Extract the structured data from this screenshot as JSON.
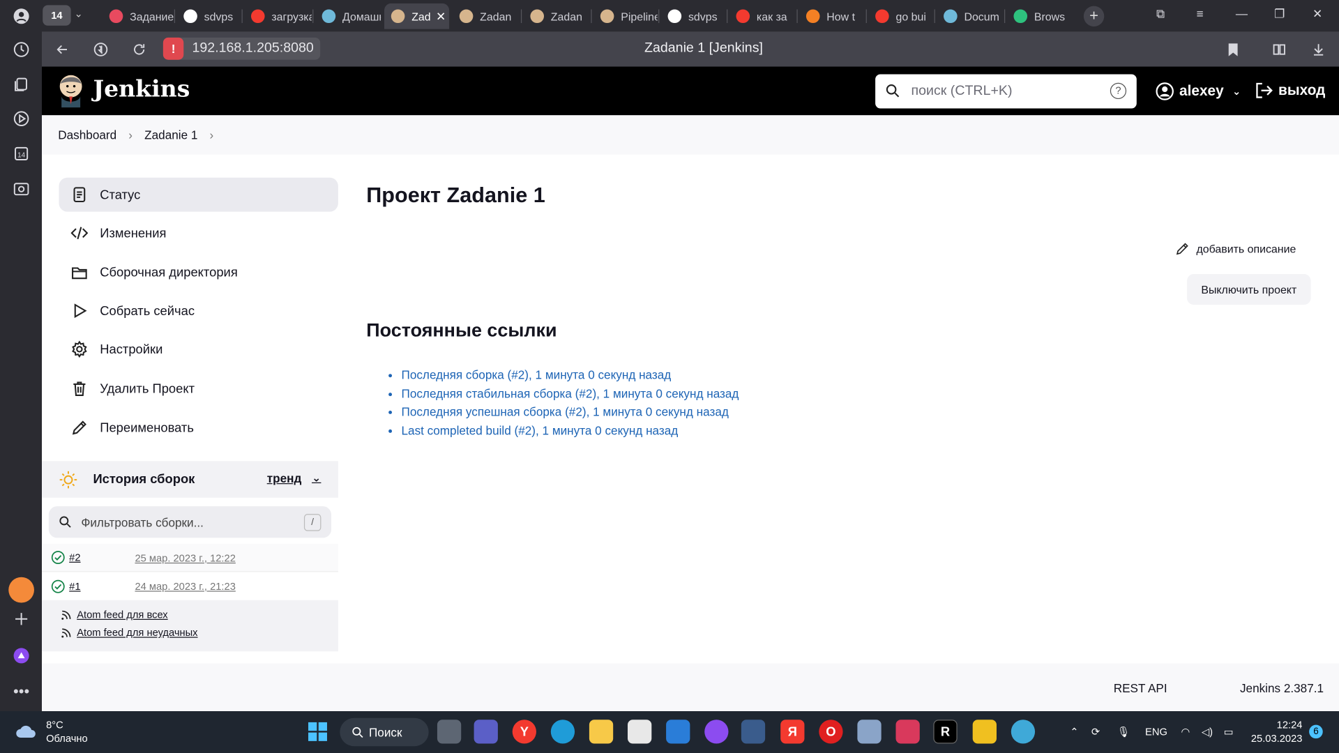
{
  "browser": {
    "tab_count": "14",
    "tabs": [
      {
        "label": "Задание",
        "color": "#e84a5f"
      },
      {
        "label": "sdvps",
        "color": "#ffffff"
      },
      {
        "label": "загрузка",
        "color": "#f33a2f"
      },
      {
        "label": "Домашнее",
        "color": "#6fb9d9"
      },
      {
        "label": "Zad",
        "color": "#d6b58d",
        "active": true
      },
      {
        "label": "Zadan",
        "color": "#d6b58d"
      },
      {
        "label": "Zadan",
        "color": "#d6b58d"
      },
      {
        "label": "Pipeline",
        "color": "#d6b58d"
      },
      {
        "label": "sdvps",
        "color": "#ffffff"
      },
      {
        "label": "как за",
        "color": "#f33a2f"
      },
      {
        "label": "How t",
        "color": "#f48024"
      },
      {
        "label": "go bui",
        "color": "#f33a2f"
      },
      {
        "label": "Docum",
        "color": "#6fb9d9"
      },
      {
        "label": "Brows",
        "color": "#2ec27e"
      }
    ],
    "url": "192.168.1.205:8080",
    "page_title": "Zadanie 1 [Jenkins]"
  },
  "header": {
    "brand": "Jenkins",
    "search_placeholder": "поиск (CTRL+K)",
    "help": "?",
    "user": "alexey",
    "logout": "выход"
  },
  "breadcrumb": {
    "items": [
      "Dashboard",
      "Zadanie 1"
    ]
  },
  "sidebar": {
    "items": [
      {
        "label": "Статус",
        "icon": "document-icon"
      },
      {
        "label": "Изменения",
        "icon": "code-icon"
      },
      {
        "label": "Сборочная директория",
        "icon": "folder-icon"
      },
      {
        "label": "Собрать сейчас",
        "icon": "play-icon"
      },
      {
        "label": "Настройки",
        "icon": "gear-icon"
      },
      {
        "label": "Удалить Проект",
        "icon": "trash-icon"
      },
      {
        "label": "Переименовать",
        "icon": "pencil-icon"
      }
    ]
  },
  "history": {
    "title": "История сборок",
    "trend": "тренд",
    "filter_placeholder": "Фильтровать сборки...",
    "shortcut": "/",
    "builds": [
      {
        "number": "#2",
        "date": "25 мар. 2023 г., 12:22",
        "status": "success"
      },
      {
        "number": "#1",
        "date": "24 мар. 2023 г., 21:23",
        "status": "success"
      }
    ],
    "feed_all": "Atom feed для всех",
    "feed_failed": "Atom feed для неудачных"
  },
  "main": {
    "title": "Проект Zadanie 1",
    "add_description": "добавить описание",
    "disable_project": "Выключить проект",
    "permalinks_title": "Постоянные ссылки",
    "permalinks": [
      "Последняя сборка (#2), 1 минута 0 секунд назад",
      "Последняя стабильная сборка (#2), 1 минута 0 секунд назад",
      "Последняя успешная сборка (#2), 1 минута 0 секунд назад",
      "Last completed build (#2), 1 минута 0 секунд назад"
    ]
  },
  "footer": {
    "rest_api": "REST API",
    "version": "Jenkins 2.387.1"
  },
  "taskbar": {
    "temperature": "8°C",
    "weather": "Облачно",
    "search": "Поиск",
    "language": "ENG",
    "time": "12:24",
    "date": "25.03.2023",
    "notifications": "6"
  },
  "colors": {
    "link": "#1d64b5",
    "success": "#138347",
    "header_bg": "#000000"
  }
}
